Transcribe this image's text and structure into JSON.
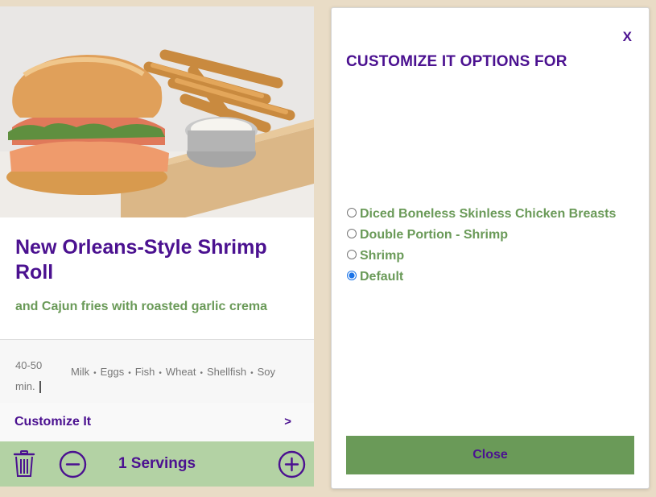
{
  "recipe": {
    "title": "New Orleans-Style Shrimp Roll",
    "subtitle": "and Cajun fries with roasted garlic crema",
    "time_line1": "40-50",
    "time_line2": "min.",
    "allergens": [
      "Milk",
      "Eggs",
      "Fish",
      "Wheat",
      "Shellfish",
      "Soy"
    ],
    "customize_label": "Customize It",
    "customize_arrow": ">",
    "servings_label": "1 Servings"
  },
  "modal": {
    "close_x": "X",
    "title": "CUSTOMIZE IT OPTIONS FOR",
    "options": [
      {
        "label": "Diced Boneless Skinless Chicken Breasts",
        "selected": false
      },
      {
        "label": "Double Portion - Shrimp",
        "selected": false
      },
      {
        "label": "Shrimp",
        "selected": false
      },
      {
        "label": "Default",
        "selected": true
      }
    ],
    "close_button": "Close"
  },
  "icons": {
    "delete": "trash-icon",
    "decrease": "minus-circle-icon",
    "increase": "plus-circle-icon"
  },
  "colors": {
    "brand_purple": "#4b1190",
    "accent_green": "#6a9a58",
    "servings_bar": "#b3d2a4",
    "radio_selected": "#1a73e8"
  }
}
